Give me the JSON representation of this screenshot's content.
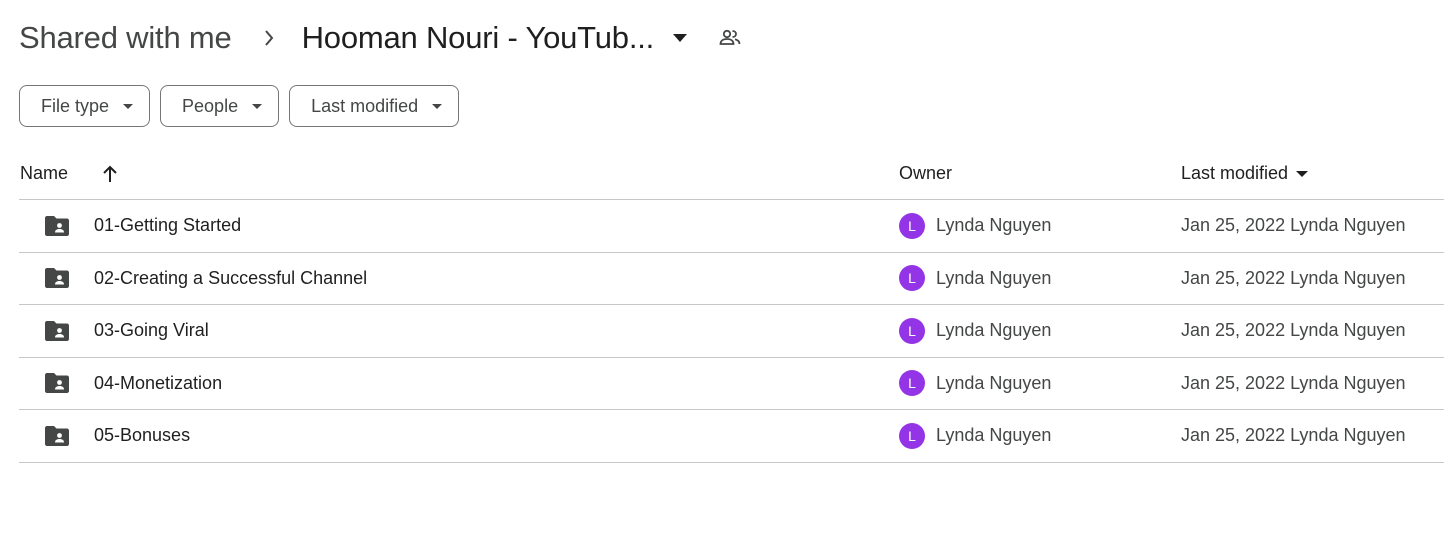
{
  "breadcrumb": {
    "root": "Shared with me",
    "separator_icon": "chevron-right-icon",
    "current": "Hooman Nouri - YouTub...",
    "dropdown_icon": "arrow-drop-down-icon",
    "shared_icon": "people-icon"
  },
  "filters": [
    {
      "label": "File type"
    },
    {
      "label": "People"
    },
    {
      "label": "Last modified"
    }
  ],
  "table": {
    "headers": {
      "name": "Name",
      "owner": "Owner",
      "modified": "Last modified",
      "sort_icon": "arrow-up-icon"
    },
    "rows": [
      {
        "name": "01-Getting Started",
        "owner_initial": "L",
        "owner": "Lynda Nguyen",
        "modified": "Jan 25, 2022 Lynda Nguyen"
      },
      {
        "name": "02-Creating a Successful Channel",
        "owner_initial": "L",
        "owner": "Lynda Nguyen",
        "modified": "Jan 25, 2022 Lynda Nguyen"
      },
      {
        "name": "03-Going Viral",
        "owner_initial": "L",
        "owner": "Lynda Nguyen",
        "modified": "Jan 25, 2022 Lynda Nguyen"
      },
      {
        "name": "04-Monetization",
        "owner_initial": "L",
        "owner": "Lynda Nguyen",
        "modified": "Jan 25, 2022 Lynda Nguyen"
      },
      {
        "name": "05-Bonuses",
        "owner_initial": "L",
        "owner": "Lynda Nguyen",
        "modified": "Jan 25, 2022 Lynda Nguyen"
      }
    ]
  },
  "colors": {
    "avatar": "#9334e6",
    "folder_icon": "#444746",
    "divider": "#c7c7c7"
  }
}
